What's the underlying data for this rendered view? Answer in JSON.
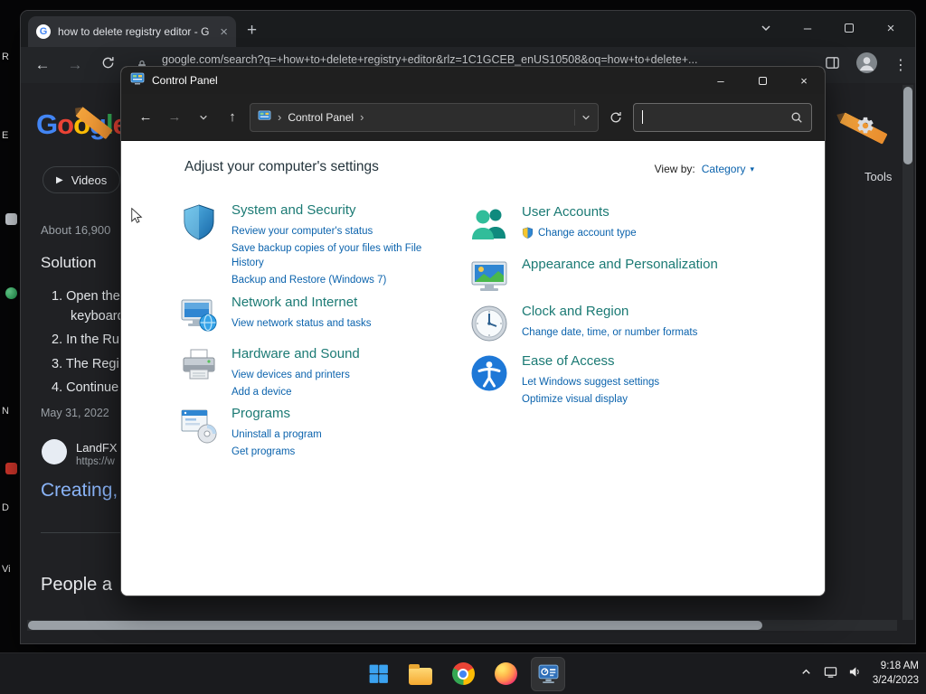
{
  "colors": {
    "cp_category": "#1b7a74",
    "cp_link": "#0b63ad",
    "result_link": "#8ab4f8",
    "g_blue": "#4285F4",
    "g_red": "#EA4335",
    "g_yellow": "#FBBC05",
    "g_green": "#34A853"
  },
  "icons": {
    "back": "←",
    "forward": "→",
    "up": "↑",
    "new_tab": "+",
    "close": "×",
    "minimize": "–",
    "kebab": "⋮",
    "breadcrumb_sep": "›",
    "dropdown": "▾",
    "play": "▶",
    "favicon_letter": "G"
  },
  "desktop": {
    "fragments": [
      "R",
      "E",
      "N",
      "D",
      "Vi"
    ]
  },
  "browser": {
    "tab_title": "how to delete registry editor - G",
    "url": "google.com/search?q=+how+to+delete+registry+editor&rlz=1C1GCEB_enUS10508&oq=how+to+delete+...",
    "page": {
      "logo_letters": [
        "G",
        "o",
        "o",
        "g",
        "l",
        "e"
      ],
      "videos_chip": "Videos",
      "results_stat": "About 16,900",
      "solution_heading": "Solution",
      "steps": [
        "1. Open the",
        "keyboard",
        "2. In the Ru",
        "3. The Regi",
        "4. Continue"
      ],
      "date_line": "May 31, 2022",
      "result_source": "LandFX",
      "result_url": "https://w",
      "result_title": "Creating,",
      "people_also_ask": "People a",
      "tools_label": "Tools"
    }
  },
  "control_panel": {
    "window_title": "Control Panel",
    "breadcrumb": "Control Panel",
    "heading": "Adjust your computer's settings",
    "view_by_label": "View by:",
    "view_by_value": "Category",
    "categories_left": [
      {
        "title": "System and Security",
        "links": [
          "Review your computer's status",
          "Save backup copies of your files with File History",
          "Backup and Restore (Windows 7)"
        ]
      },
      {
        "title": "Network and Internet",
        "links": [
          "View network status and tasks"
        ]
      },
      {
        "title": "Hardware and Sound",
        "links": [
          "View devices and printers",
          "Add a device"
        ]
      },
      {
        "title": "Programs",
        "links": [
          "Uninstall a program",
          "Get programs"
        ]
      }
    ],
    "categories_right": [
      {
        "title": "User Accounts",
        "links": [
          "Change account type"
        ]
      },
      {
        "title": "Appearance and Personalization",
        "links": []
      },
      {
        "title": "Clock and Region",
        "links": [
          "Change date, time, or number formats"
        ]
      },
      {
        "title": "Ease of Access",
        "links": [
          "Let Windows suggest settings",
          "Optimize visual display"
        ]
      }
    ]
  },
  "taskbar": {
    "time": "9:18 AM",
    "date": "3/24/2023"
  }
}
